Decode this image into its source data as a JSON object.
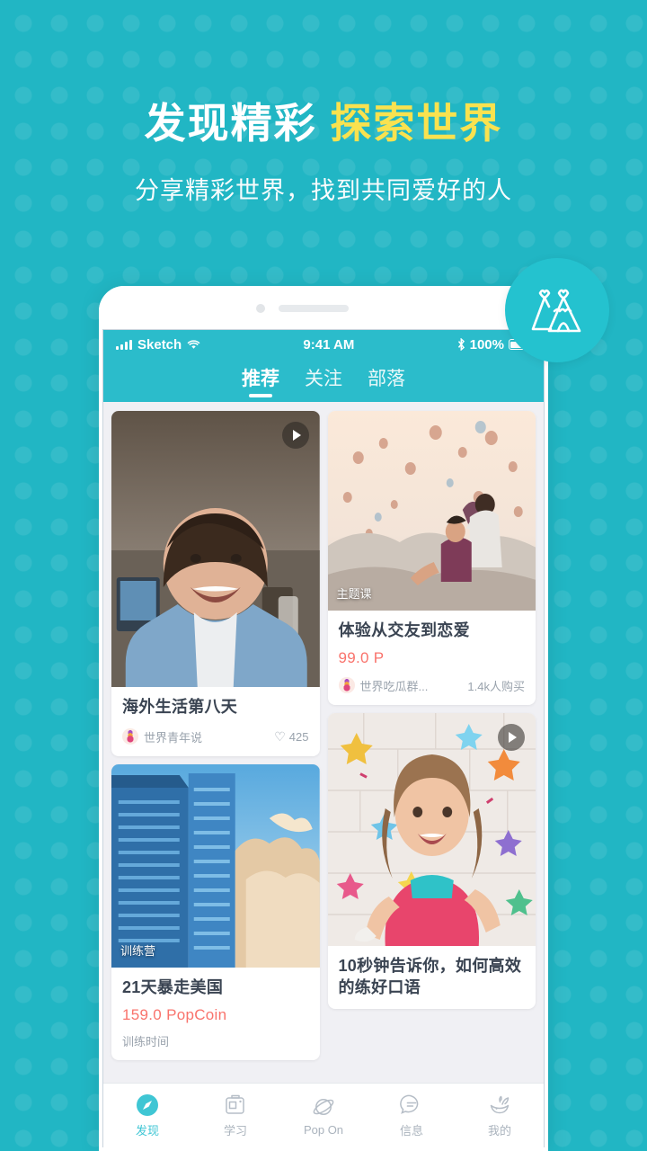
{
  "theme": {
    "brand_teal": "#21b6c4",
    "header_teal": "#2bbccb",
    "accent_yellow": "#f9e24f",
    "price_red": "#f9736c",
    "active_nav": "#3fc6d4"
  },
  "hero": {
    "title_white": "发现精彩",
    "title_accent": "探索世界",
    "subtitle": "分享精彩世界，找到共同爱好的人"
  },
  "logo": {
    "name": "teepee-logo"
  },
  "status_bar": {
    "carrier": "Sketch",
    "time": "9:41 AM",
    "battery_percent": "100%",
    "icons": [
      "signal-icon",
      "wifi-icon",
      "bluetooth-icon",
      "battery-icon"
    ]
  },
  "tabs": [
    {
      "label": "推荐",
      "active": true
    },
    {
      "label": "关注",
      "active": false
    },
    {
      "label": "部落",
      "active": false
    }
  ],
  "feed": {
    "left_column": [
      {
        "kind": "video",
        "badge": "",
        "title": "海外生活第八天",
        "price": "",
        "author": "世界青年说",
        "stat": "425",
        "stat_icon": "heart-icon",
        "subtext": "",
        "has_play": true
      },
      {
        "kind": "course",
        "badge": "训练营",
        "title": "21天暴走美国",
        "price": "159.0 PopCoin",
        "author": "",
        "stat": "",
        "stat_icon": "",
        "subtext": "训练时间",
        "has_play": false
      }
    ],
    "right_column": [
      {
        "kind": "course",
        "badge": "主题课",
        "title": "体验从交友到恋爱",
        "price": "99.0 P",
        "author": "世界吃瓜群...",
        "stat": "1.4k人购买",
        "stat_icon": "",
        "subtext": "",
        "has_play": false
      },
      {
        "kind": "video",
        "badge": "",
        "title": "10秒钟告诉你，如何高效的练好口语",
        "price": "",
        "author": "",
        "stat": "",
        "stat_icon": "",
        "subtext": "",
        "has_play": true
      }
    ]
  },
  "bottom_nav": [
    {
      "label": "发现",
      "icon": "compass-icon",
      "active": true
    },
    {
      "label": "学习",
      "icon": "briefcase-icon",
      "active": false
    },
    {
      "label": "Pop On",
      "icon": "planet-icon",
      "active": false
    },
    {
      "label": "信息",
      "icon": "chat-icon",
      "active": false
    },
    {
      "label": "我的",
      "icon": "whale-icon",
      "active": false
    }
  ]
}
